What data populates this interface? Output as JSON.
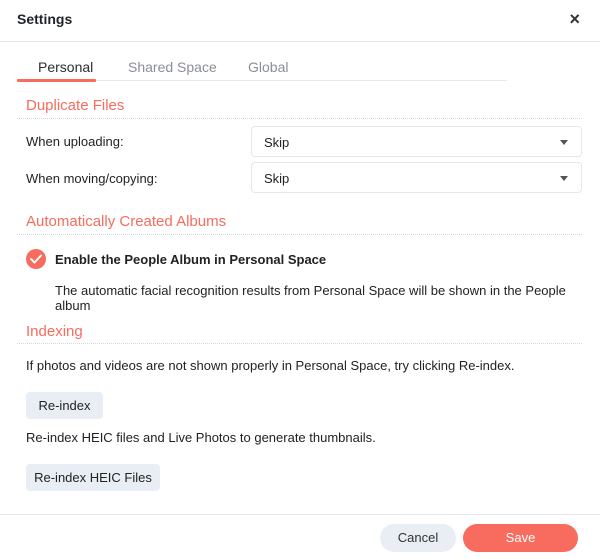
{
  "dialog": {
    "title": "Settings",
    "close_icon": "×"
  },
  "tabs": [
    {
      "label": "Personal",
      "active": true
    },
    {
      "label": "Shared Space",
      "active": false
    },
    {
      "label": "Global",
      "active": false
    }
  ],
  "duplicate_files": {
    "title": "Duplicate Files",
    "uploading": {
      "label": "When uploading:",
      "value": "Skip"
    },
    "moving": {
      "label": "When moving/copying:",
      "value": "Skip"
    }
  },
  "albums": {
    "title": "Automatically Created Albums",
    "people_album": {
      "label": "Enable the People Album in Personal Space",
      "checked": true,
      "description": "The automatic facial recognition results from Personal Space will be shown in the People album"
    }
  },
  "indexing": {
    "title": "Indexing",
    "reindex_desc": "If photos and videos are not shown properly in Personal Space, try clicking Re-index.",
    "reindex_label": "Re-index",
    "heic_desc": "Re-index HEIC files and Live Photos to generate thumbnails.",
    "heic_label": "Re-index HEIC Files"
  },
  "footer": {
    "cancel_label": "Cancel",
    "save_label": "Save"
  },
  "colors": {
    "accent": "#f76c5e",
    "button_grey": "#e9eef4"
  }
}
